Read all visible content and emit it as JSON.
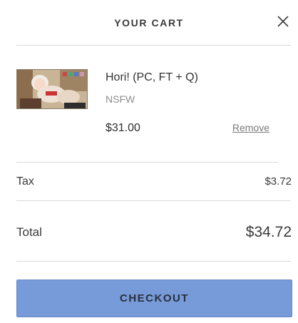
{
  "header": {
    "title": "YOUR CART",
    "close_icon": "close-icon"
  },
  "cart_item": {
    "name": "Hori! (PC, FT + Q)",
    "tag": "NSFW",
    "price": "$31.00",
    "remove_label": "Remove"
  },
  "summary": {
    "tax_label": "Tax",
    "tax_value": "$3.72",
    "total_label": "Total",
    "total_value": "$34.72"
  },
  "checkout": {
    "label": "CHECKOUT",
    "color": "#779bd9"
  }
}
